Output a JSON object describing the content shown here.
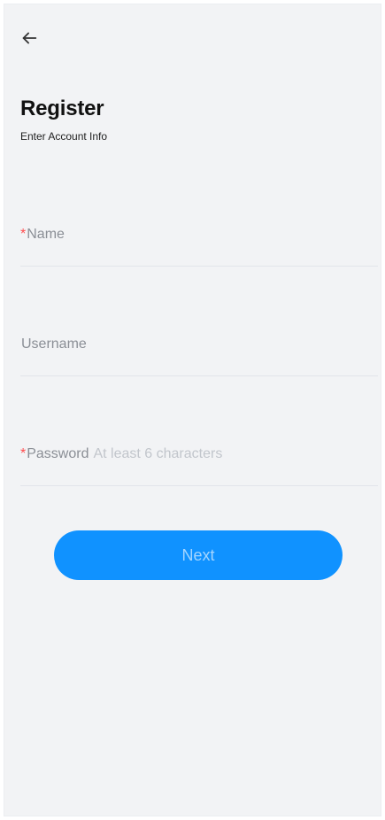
{
  "header": {
    "back_icon": "arrow-left-icon"
  },
  "page": {
    "title": "Register",
    "subtitle": "Enter Account Info"
  },
  "form": {
    "fields": [
      {
        "required_mark": "*",
        "label": "Name",
        "hint": "",
        "value": ""
      },
      {
        "required_mark": "",
        "label": "Username",
        "hint": "",
        "value": ""
      },
      {
        "required_mark": "*",
        "label": "Password",
        "hint": "At least 6 characters",
        "value": ""
      }
    ],
    "next_label": "Next"
  },
  "colors": {
    "background": "#f2f3f5",
    "accent": "#1092ff",
    "required": "#ff4d4f",
    "label": "#8b8f96",
    "hint": "#c2c6cc",
    "divider": "#e2e5ea",
    "title": "#111111"
  }
}
